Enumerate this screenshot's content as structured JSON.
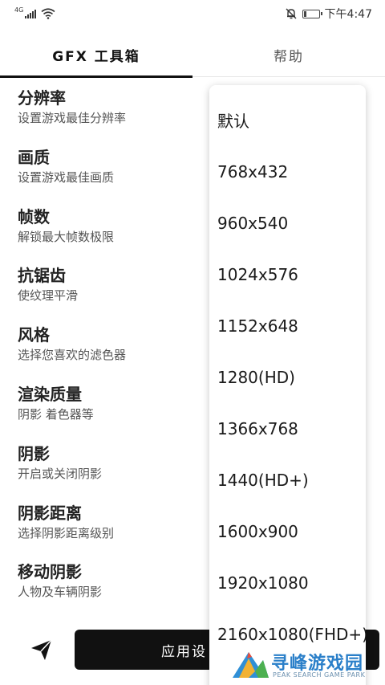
{
  "status_bar": {
    "network": "4G",
    "time": "下午4:47",
    "battery_level": 0.2
  },
  "tabs": [
    {
      "label": "GFX 工具箱",
      "active": true
    },
    {
      "label": "帮助",
      "active": false
    }
  ],
  "settings": [
    {
      "title": "分辨率",
      "desc": "设置游戏最佳分辨率"
    },
    {
      "title": "画质",
      "desc": "设置游戏最佳画质"
    },
    {
      "title": "帧数",
      "desc": "解锁最大帧数极限"
    },
    {
      "title": "抗锯齿",
      "desc": "使纹理平滑"
    },
    {
      "title": "风格",
      "desc": "选择您喜欢的滤色器"
    },
    {
      "title": "渲染质量",
      "desc": "阴影 着色器等"
    },
    {
      "title": "阴影",
      "desc": "开启或关闭阴影"
    },
    {
      "title": "阴影距离",
      "desc": "选择阴影距离级别"
    },
    {
      "title": "移动阴影",
      "desc": "人物及车辆阴影"
    }
  ],
  "apply_button": {
    "label": "应用设"
  },
  "dropdown": {
    "options": [
      "默认",
      "768x432",
      "960x540",
      "1024x576",
      "1152x648",
      "1280(HD)",
      "1366x768",
      "1440(HD+)",
      "1600x900",
      "1920x1080",
      "2160x1080(FHD+)"
    ]
  },
  "watermark": {
    "title": "寻峰游戏园",
    "subtitle": "PEAK SEARCH GAME PARK"
  },
  "colors": {
    "accent": "#111111",
    "watermark": "#2a7fc9"
  }
}
